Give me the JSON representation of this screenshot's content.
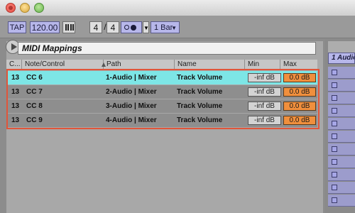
{
  "toolbar": {
    "tap_label": "TAP",
    "tempo": "120.00",
    "signature_numerator": "4",
    "signature_slash": "/",
    "signature_denominator": "4",
    "metro_dropdown": "▼",
    "quantization": "1 Bar",
    "quantization_arrow": "▼"
  },
  "panel": {
    "title": "MIDI Mappings"
  },
  "table": {
    "columns": {
      "channel": "C...",
      "note_control": "Note/Control",
      "path": "Path",
      "name": "Name",
      "min": "Min",
      "max": "Max"
    },
    "rows": [
      {
        "channel": "13",
        "control": "CC 6",
        "path": "1-Audio | Mixer",
        "name": "Track Volume",
        "min": "-inf dB",
        "max": "0.0 dB",
        "selected": true
      },
      {
        "channel": "13",
        "control": "CC 7",
        "path": "2-Audio | Mixer",
        "name": "Track Volume",
        "min": "-inf dB",
        "max": "0.0 dB",
        "selected": false
      },
      {
        "channel": "13",
        "control": "CC 8",
        "path": "3-Audio | Mixer",
        "name": "Track Volume",
        "min": "-inf dB",
        "max": "0.0 dB",
        "selected": false
      },
      {
        "channel": "13",
        "control": "CC 9",
        "path": "4-Audio | Mixer",
        "name": "Track Volume",
        "min": "-inf dB",
        "max": "0.0 dB",
        "selected": false
      }
    ]
  },
  "right_panel": {
    "track_title": "1 Audio"
  },
  "colors": {
    "selected_row": "#7de6e6",
    "max_value": "#f08f3d",
    "highlight_frame": "#e0553a",
    "accent_blue": "#b7b7ea"
  }
}
